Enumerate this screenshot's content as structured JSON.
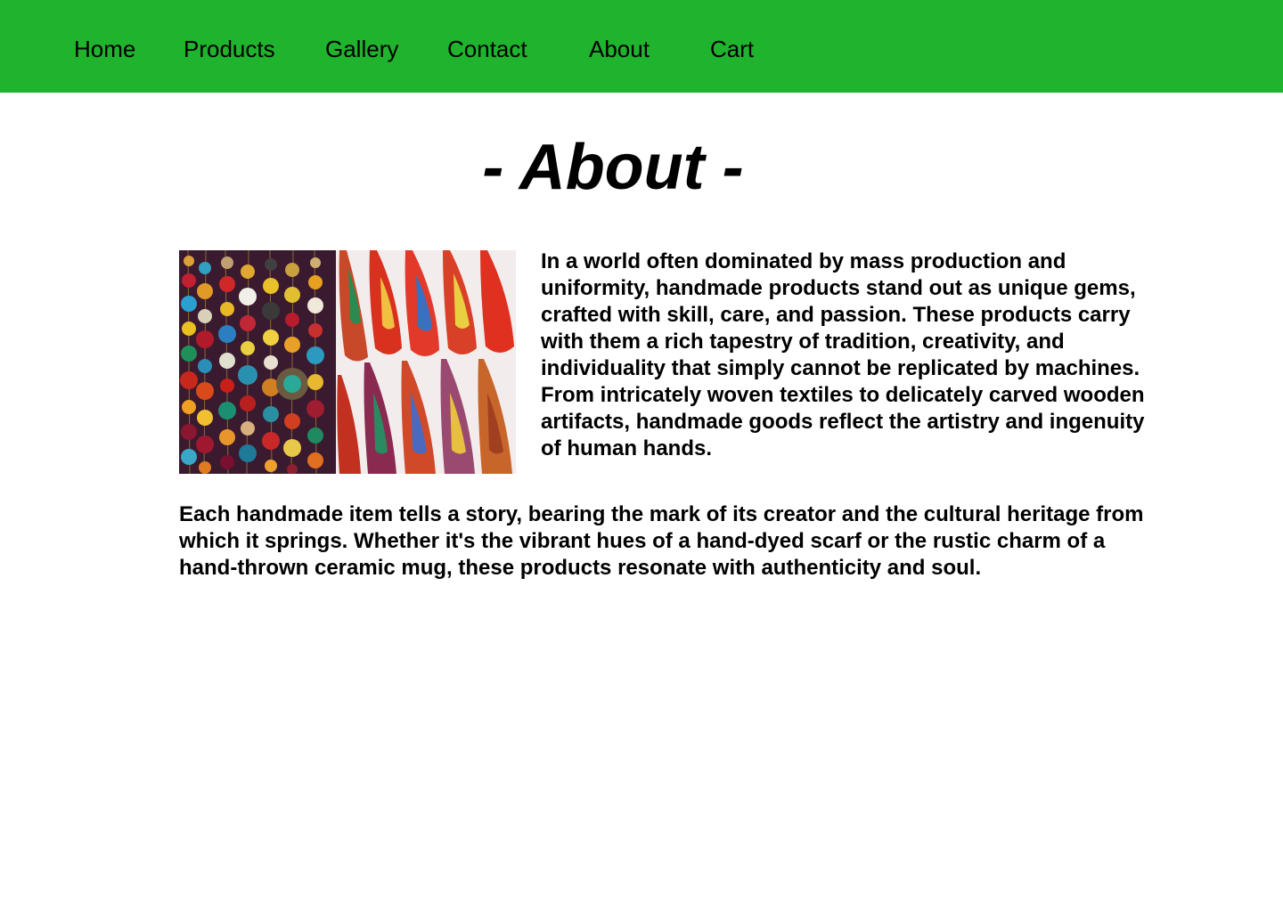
{
  "nav": {
    "items": [
      {
        "label": "Home"
      },
      {
        "label": "Products"
      },
      {
        "label": "Gallery"
      },
      {
        "label": "Contact"
      },
      {
        "label": "About"
      },
      {
        "label": "Cart"
      }
    ],
    "background_color": "#1fb32e"
  },
  "main": {
    "title": "- About -",
    "image": {
      "name": "handmade-products-photo",
      "depicts": "colorful beaded necklaces and embroidered leather slippers"
    },
    "paragraphs": [
      "In a world often dominated by mass production and uniformity, handmade products stand out as unique gems, crafted with skill, care, and passion. These products carry with them a rich tapestry of tradition, creativity, and individuality that simply cannot be replicated by machines. From intricately woven textiles to delicately carved wooden artifacts, handmade goods reflect the artistry and ingenuity of human hands.",
      "Each handmade item tells a story, bearing the mark of its creator and the cultural heritage from which it springs. Whether it's the vibrant hues of a hand-dyed scarf or the rustic charm of a hand-thrown ceramic mug, these products resonate with authenticity and soul."
    ]
  }
}
